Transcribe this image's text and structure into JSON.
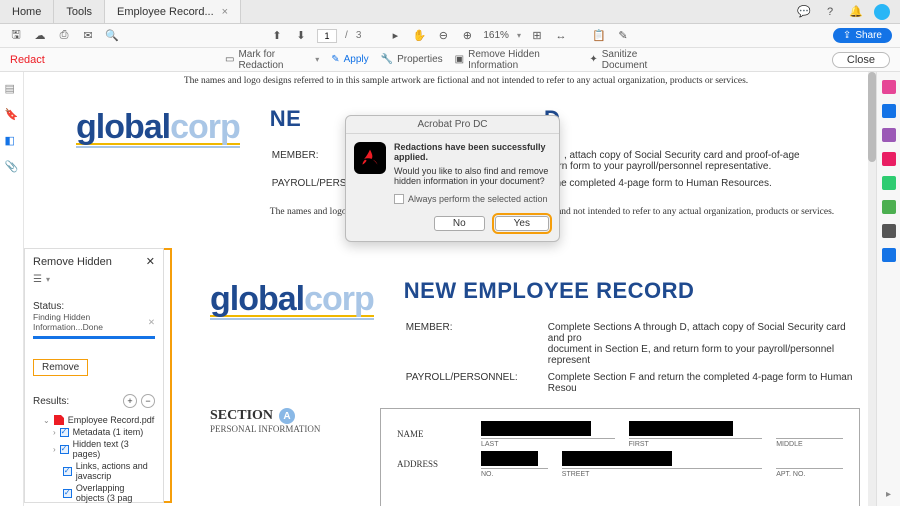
{
  "tabs": {
    "home": "Home",
    "tools": "Tools",
    "doc": "Employee Record..."
  },
  "toolbar": {
    "page_current": "1",
    "page_sep": "/",
    "page_total": "3",
    "zoom": "161%",
    "share": "Share"
  },
  "redactbar": {
    "title": "Redact",
    "mark": "Mark for Redaction",
    "apply": "Apply",
    "properties": "Properties",
    "remove_hidden": "Remove Hidden Information",
    "sanitize": "Sanitize Document",
    "close": "Close"
  },
  "doc": {
    "fiction": "The names and logo designs referred to in this sample artwork are fictional and not intended to refer to any actual organization, products or services.",
    "logo_a": "global",
    "logo_b": "corp",
    "h1_short": "NE",
    "h1_short2": "D",
    "h1": "NEW EMPLOYEE RECORD",
    "member": "MEMBER:",
    "member_line1": ", attach copy of Social Security card and proof-of-age",
    "member_line2_1": "urn form to your payroll/personnel representative.",
    "member_full1": "Complete Sections A through D, attach copy of Social Security card and pro",
    "member_full2": "document in Section E, and return form to your payroll/personnel represent",
    "payroll": "PAYROLL/PERSONNEL:",
    "payroll_line": "Complete Section F and return the completed 4-page form to Human Resources.",
    "payroll_line2": "Complete Section F and return the completed 4-page form to Human Resou",
    "section": "SECTION",
    "sectionA": "A",
    "personal": "PERSONAL INFORMATION",
    "name": "NAME",
    "addr": "ADDRESS",
    "last": "LAST",
    "first": "FIRST",
    "middle": "MIDDLE",
    "no": "NO.",
    "street": "STREET",
    "apt": "APT. NO."
  },
  "dialog": {
    "title": "Acrobat Pro DC",
    "headline": "Redactions have been successfully applied.",
    "body": "Would you like to also find and remove hidden information in your document?",
    "checkbox": "Always perform the selected action",
    "no": "No",
    "yes": "Yes"
  },
  "panel": {
    "title": "Remove Hidden",
    "status_label": "Status:",
    "status_text": "Finding Hidden Information...Done",
    "remove": "Remove",
    "results": "Results:",
    "file": "Employee Record.pdf",
    "items": [
      "Metadata (1 item)",
      "Hidden text (3 pages)",
      "Links, actions and javascrip",
      "Overlapping objects (3 pag"
    ]
  }
}
